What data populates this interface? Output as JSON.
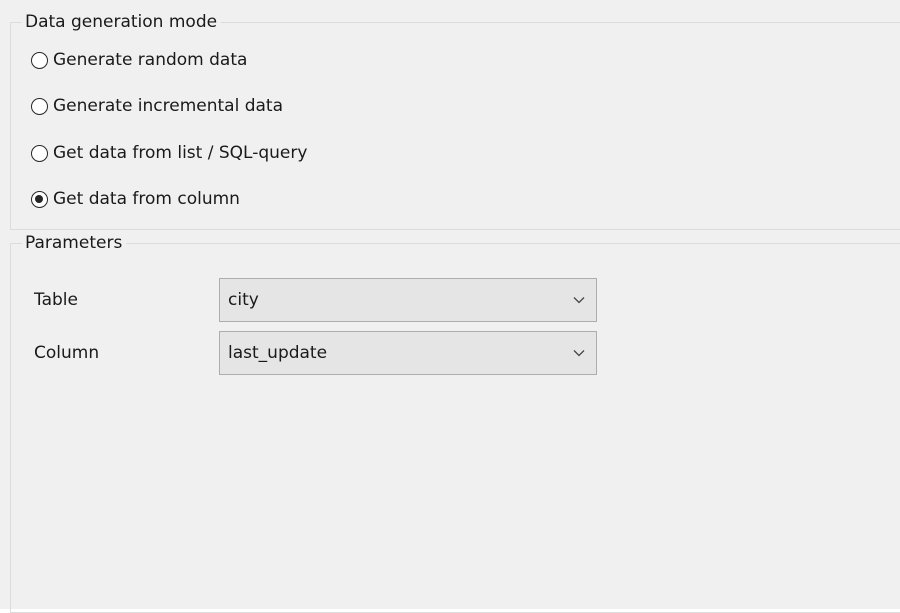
{
  "mode_group": {
    "title": "Data generation mode",
    "options": [
      {
        "label": "Generate random data",
        "checked": false
      },
      {
        "label": "Generate incremental data",
        "checked": false
      },
      {
        "label": "Get data from list / SQL-query",
        "checked": false
      },
      {
        "label": "Get data from column",
        "checked": true
      }
    ]
  },
  "params_group": {
    "title": "Parameters",
    "table": {
      "label": "Table",
      "value": "city"
    },
    "column": {
      "label": "Column",
      "value": "last_update"
    }
  },
  "icons": {
    "dropdown": "chevron-down-icon",
    "radio_checked": "radio-checked-icon",
    "radio_unchecked": "radio-unchecked-icon"
  }
}
